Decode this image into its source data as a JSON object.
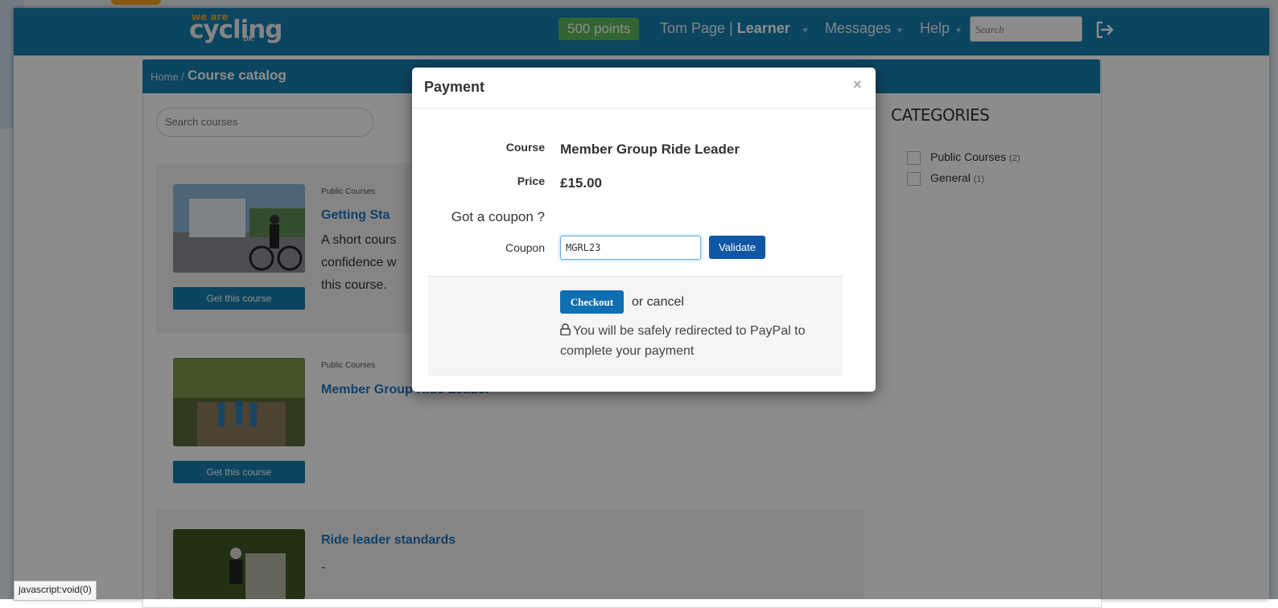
{
  "logo": {
    "top": "we are",
    "main": "cycling",
    "sub": "UK"
  },
  "header": {
    "points": "500 points",
    "user_name": "Tom Page",
    "user_sep": " | ",
    "user_role": "Learner",
    "messages": "Messages",
    "help": "Help",
    "search_placeholder": "Search"
  },
  "breadcrumb": {
    "home": "Home",
    "sep": " / ",
    "current": "Course catalog"
  },
  "course_search_placeholder": "Search courses",
  "courses": [
    {
      "category": "Public Courses",
      "title": "Getting Sta",
      "desc": [
        "A short cours",
        "confidence w",
        "this course."
      ],
      "button": "Get this course"
    },
    {
      "category": "Public Courses",
      "title": "Member Group Ride Leader",
      "button": "Get this course"
    },
    {
      "category": "",
      "title": "Ride leader standards",
      "desc": [
        "-"
      ]
    }
  ],
  "categories": {
    "title": "CATEGORIES",
    "items": [
      {
        "label": "Public Courses",
        "count": "(2)"
      },
      {
        "label": "General",
        "count": "(1)"
      }
    ]
  },
  "status_bar": "javascript:void(0)",
  "modal": {
    "title": "Payment",
    "close": "×",
    "course_label": "Course",
    "course_value": "Member Group Ride Leader",
    "price_label": "Price",
    "price_value": "£15.00",
    "coupon_prompt": "Got a coupon ?",
    "coupon_label": "Coupon",
    "coupon_value": "MGRL23",
    "validate": "Validate",
    "checkout": "Checkout",
    "or_cancel": "or cancel",
    "redirect_text": "You will be safely redirected to PayPal to complete your payment"
  },
  "colors": {
    "brand_blue": "#177fb0",
    "points_green": "#5eb95e",
    "validate_blue": "#0f56a6",
    "logo_orange": "#f5a623"
  }
}
